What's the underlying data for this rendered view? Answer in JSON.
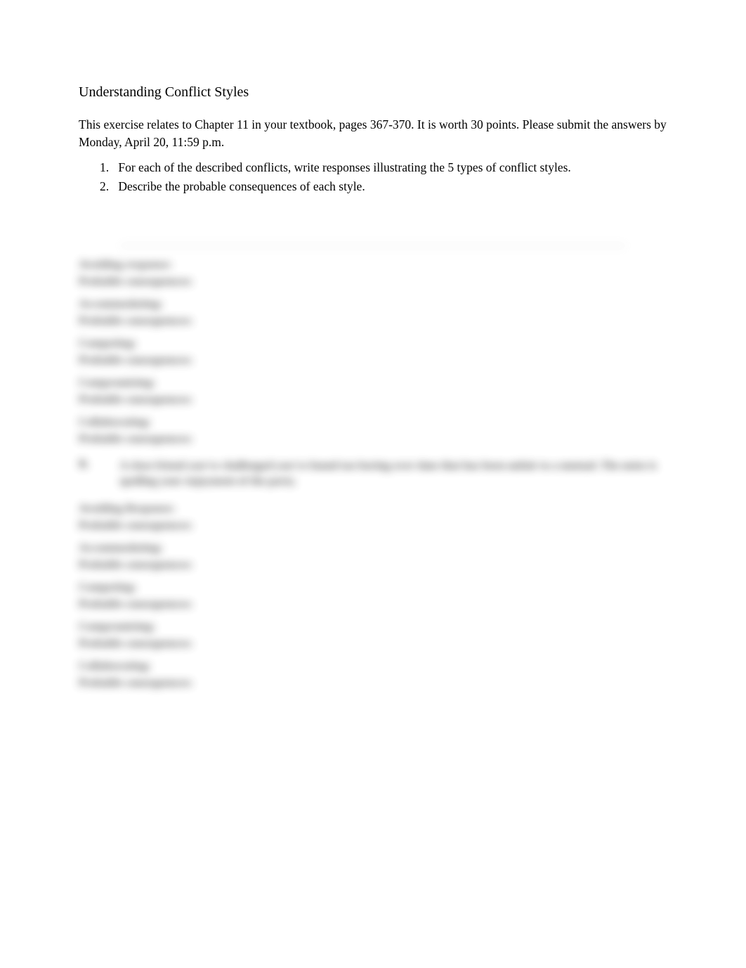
{
  "title": "Understanding Conflict Styles",
  "intro": "This exercise relates to Chapter 11 in your textbook, pages 367-370. It is worth 30 points. Please submit the answers by Monday, April 20, 11:59 p.m.",
  "instructions": {
    "item1_num": "1.",
    "item1_text": "For each of the described conflicts, write responses illustrating the 5 types of conflict styles.",
    "item2_num": "2.",
    "item2_prefix": "Describe the ",
    "item2_mid": "probable consequences",
    "item2_suffix": "   of each style."
  },
  "blurred": {
    "avoiding": "Avoiding response:",
    "consequence": "Probable consequences:",
    "accommodating": "Accommodating:",
    "competing": "Competing:",
    "compromising": "Compromising:",
    "collaborating": "Collaborating:",
    "avoiding2": "Avoiding Response:",
    "scenario_letter": "B.",
    "scenario_text": "A close friend you've challenged you've found too boring over time that has been unfair to a mutual. The noise is spoiling your enjoyment of the party."
  }
}
